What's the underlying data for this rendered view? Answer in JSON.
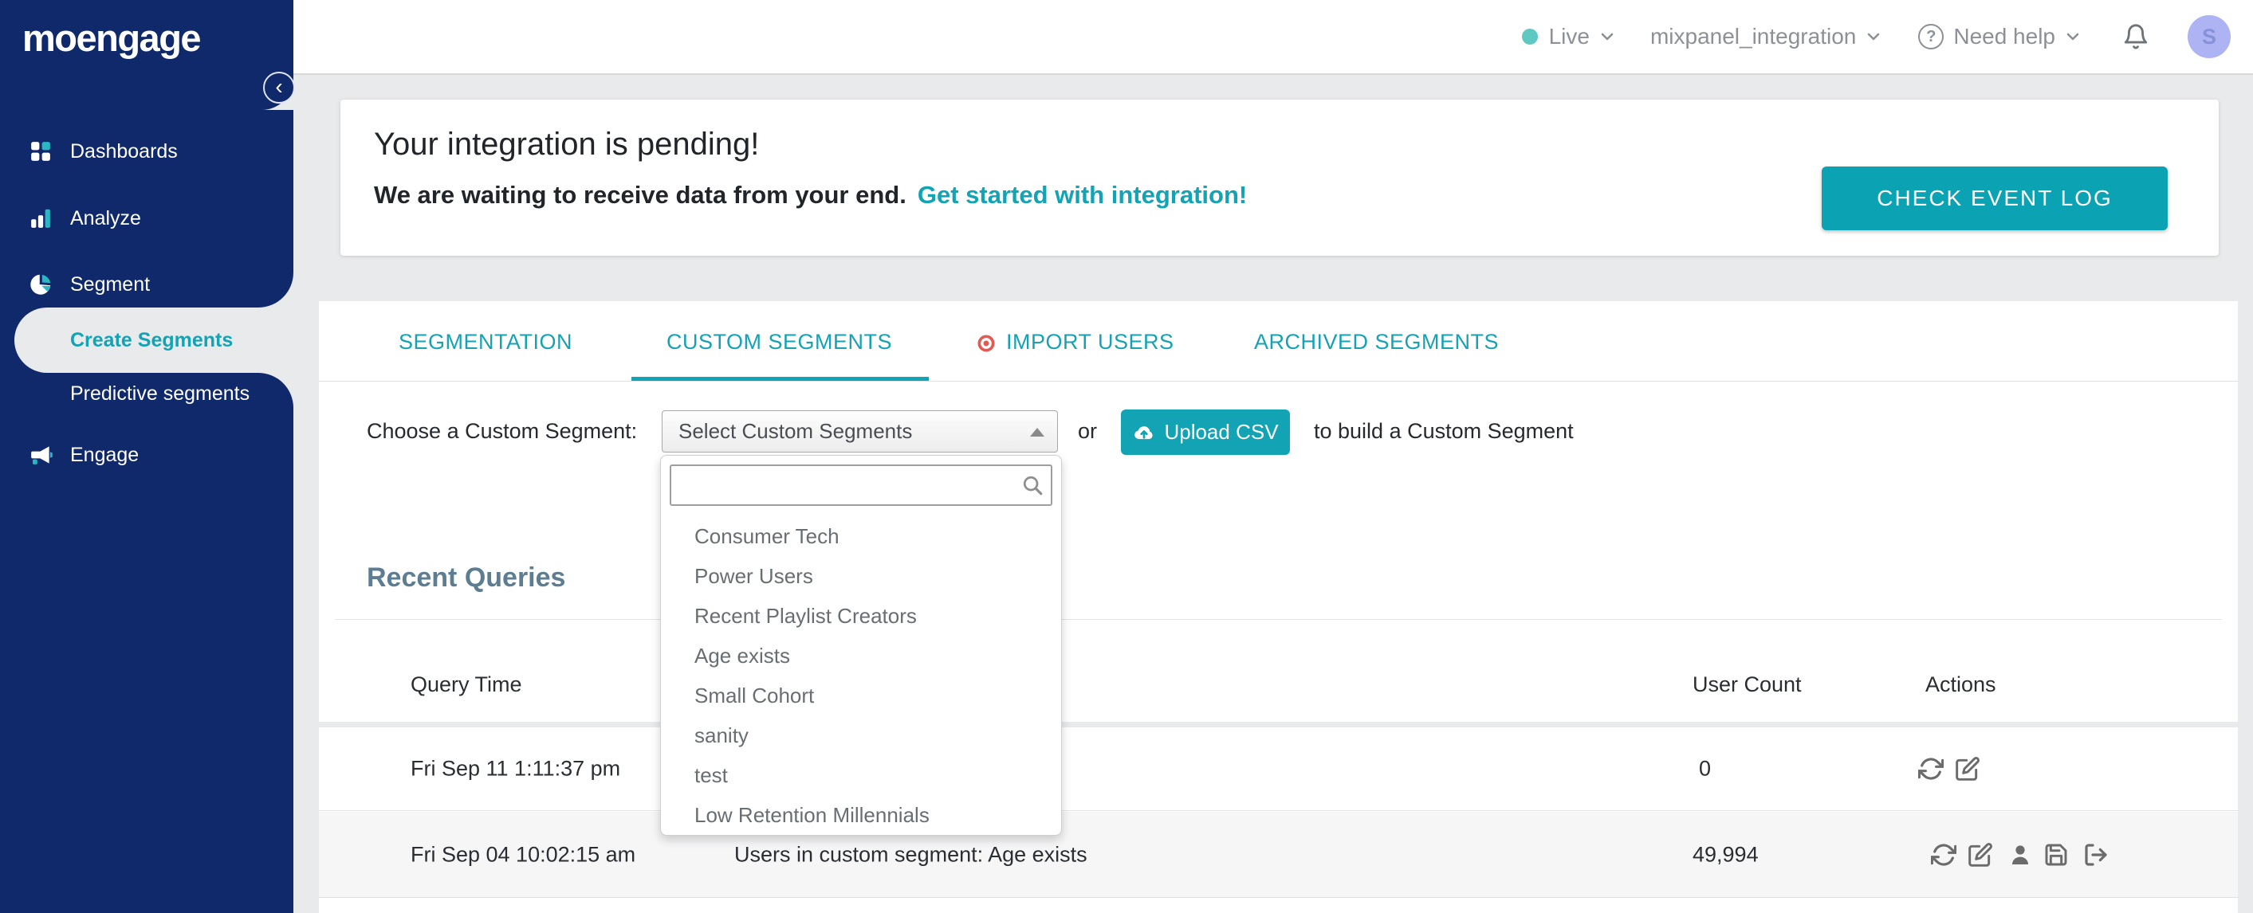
{
  "sidebar": {
    "logo": "moengage",
    "collapse_glyph": "‹",
    "items": [
      {
        "label": "Dashboards"
      },
      {
        "label": "Analyze"
      },
      {
        "label": "Segment"
      },
      {
        "label": "Create Segments",
        "active": true
      },
      {
        "label": "Predictive segments"
      },
      {
        "label": "Engage"
      }
    ]
  },
  "header": {
    "environment": "Live",
    "project": "mixpanel_integration",
    "help_glyph": "?",
    "help_label": "Need help",
    "avatar_initial": "S"
  },
  "banner": {
    "title": "Your integration is pending!",
    "subtitle": "We are waiting to receive data from your end.",
    "link_label": "Get started with integration!",
    "button_label": "CHECK EVENT LOG"
  },
  "tabs": [
    {
      "label": "SEGMENTATION",
      "active": false
    },
    {
      "label": "CUSTOM SEGMENTS",
      "active": true
    },
    {
      "label": "IMPORT USERS",
      "active": false,
      "badge": "red-target-dot"
    },
    {
      "label": "ARCHIVED SEGMENTS",
      "active": false
    }
  ],
  "picker": {
    "label": "Choose a Custom Segment:",
    "select_value": "Select Custom Segments",
    "or_label": "or",
    "upload_label": "Upload CSV",
    "suffix_label": "to build a Custom Segment",
    "search_placeholder": "",
    "options": [
      "Consumer Tech",
      "Power Users",
      "Recent Playlist Creators",
      "Age exists",
      "Small Cohort",
      "sanity",
      "test",
      "Low Retention Millennials"
    ]
  },
  "recent_queries": {
    "title": "Recent Queries",
    "columns": [
      "Query Time",
      "User Count",
      "Actions"
    ],
    "rows": [
      {
        "query_time": "Fri Sep 11 1:11:37 pm",
        "query": "",
        "user_count": "0",
        "actions": [
          "refresh",
          "edit"
        ]
      },
      {
        "query_time": "Fri Sep 04 10:02:15 am",
        "query": "Users in custom segment: Age exists",
        "user_count": "49,994",
        "actions": [
          "refresh",
          "edit",
          "user",
          "save",
          "export"
        ]
      }
    ]
  },
  "colors": {
    "sidebar_navy": "#10296b",
    "accent_teal": "#12a3b4",
    "live_dot": "#5ec9c1",
    "import_dot_red": "#e15b52",
    "heading_slate": "#5d7d92",
    "avatar_bg": "#aeb3f4",
    "page_bg": "#e9eaeb"
  }
}
